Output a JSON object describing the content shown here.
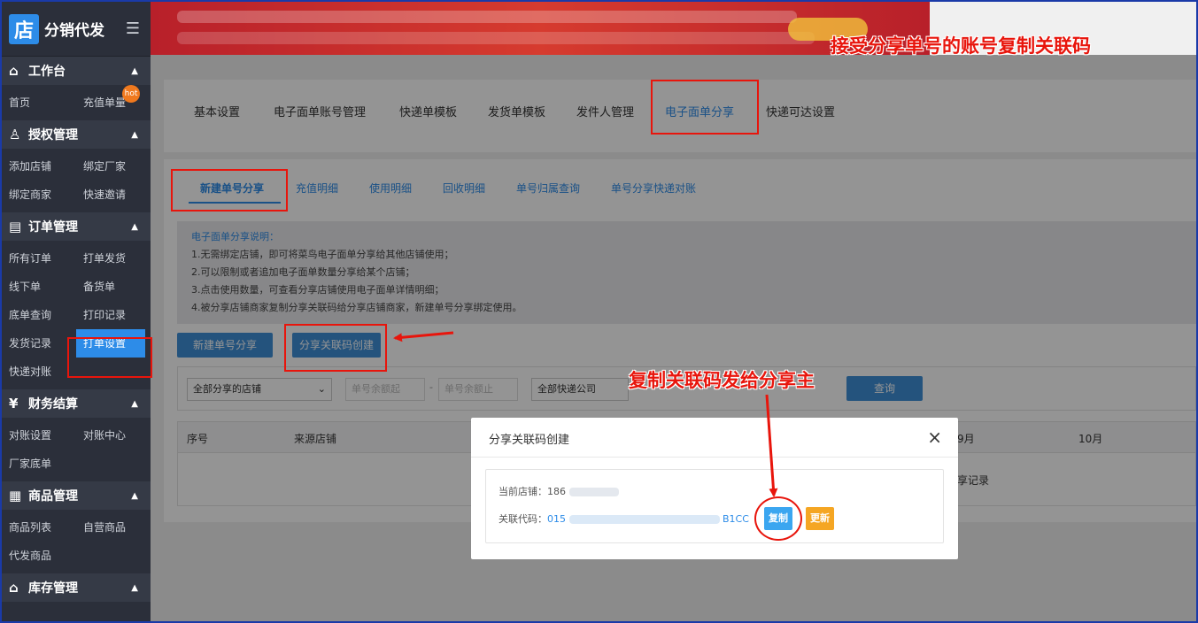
{
  "sidebar": {
    "logo_icon": "店",
    "logo_text": "分销代发",
    "menu_icon": "☰",
    "sections": [
      {
        "icon": "⌂",
        "title": "工作台",
        "items": [
          "首页",
          "充值单量"
        ]
      },
      {
        "icon": "♙",
        "title": "授权管理",
        "items": [
          "添加店铺",
          "绑定厂家",
          "绑定商家",
          "快速邀请"
        ]
      },
      {
        "icon": "▤",
        "title": "订单管理",
        "items": [
          "所有订单",
          "打单发货",
          "线下单",
          "备货单",
          "底单查询",
          "打印记录",
          "发货记录",
          "打单设置",
          "快递对账"
        ]
      },
      {
        "icon": "¥",
        "title": "财务结算",
        "items": [
          "对账设置",
          "对账中心",
          "厂家底单"
        ]
      },
      {
        "icon": "▦",
        "title": "商品管理",
        "items": [
          "商品列表",
          "自营商品",
          "代发商品"
        ]
      },
      {
        "icon": "⌂",
        "title": "库存管理",
        "items": []
      }
    ],
    "hot_badge": "hot",
    "active_item": "打单设置"
  },
  "annotations": {
    "top": "接受分享单号的账号复制关联码",
    "middle": "复制关联码发给分享主"
  },
  "top_tabs": [
    "基本设置",
    "电子面单账号管理",
    "快递单模板",
    "发货单模板",
    "发件人管理",
    "电子面单分享",
    "快递可达设置"
  ],
  "sub_tabs": [
    "新建单号分享",
    "充值明细",
    "使用明细",
    "回收明细",
    "单号归属查询",
    "单号分享快递对账"
  ],
  "description": {
    "title": "电子面单分享说明：",
    "lines": [
      "1.无需绑定店铺，即可将菜鸟电子面单分享给其他店铺使用；",
      "2.可以限制或者追加电子面单数量分享给某个店铺；",
      "3.点击使用数量，可查看分享店铺使用电子面单详情明细；",
      "4.被分享店铺商家复制分享关联码给分享店铺商家，新建单号分享绑定使用。"
    ]
  },
  "buttons": {
    "new_share": "新建单号分享",
    "create_code": "分享关联码创建",
    "query": "查询"
  },
  "filter": {
    "shop_select": "全部分享的店铺",
    "min_placeholder": "单号余额起",
    "dash": "-",
    "max_placeholder": "单号余额止",
    "company_select": "全部快递公司"
  },
  "table": {
    "headers": [
      "序号",
      "来源店铺",
      "9月",
      "10月"
    ],
    "empty_text": "享记录"
  },
  "modal": {
    "title": "分享关联码创建",
    "close": "×",
    "shop_label": "当前店铺：",
    "shop_value": "186",
    "code_label": "关联代码：",
    "code_prefix": "015",
    "code_suffix": "B1CC",
    "copy_button": "复制",
    "update_button": "更新"
  },
  "colors": {
    "accent": "#2d8ce8",
    "annotation": "#e8150c",
    "copy_btn": "#3ba6f0",
    "update_btn": "#f5a623"
  }
}
